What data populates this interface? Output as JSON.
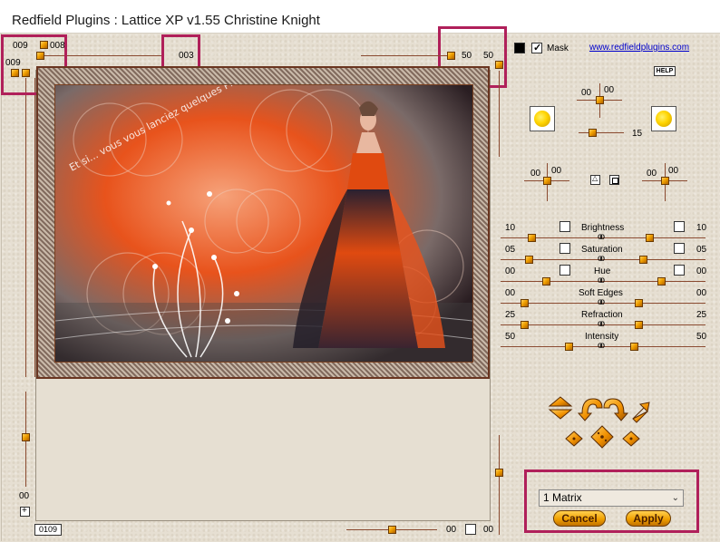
{
  "window": {
    "title": "Redfield Plugins : Lattice XP v1.55   Christine Knight"
  },
  "top_left": {
    "val_a": "009",
    "val_b": "008",
    "val_c": "009",
    "val_d": "003"
  },
  "top_right": {
    "val_a": "50",
    "val_b": "50"
  },
  "mask": {
    "label": "Mask",
    "link": "www.redfieldplugins.com",
    "help": "HELP"
  },
  "light": {
    "a": "00",
    "b": "00",
    "c": "15"
  },
  "mid": {
    "left_a": "00",
    "left_b": "00",
    "right_a": "00",
    "right_b": "00"
  },
  "sliders": [
    {
      "label": "Brightness",
      "left": "10",
      "right": "10"
    },
    {
      "label": "Saturation",
      "left": "05",
      "right": "05"
    },
    {
      "label": "Hue",
      "left": "00",
      "right": "00"
    },
    {
      "label": "Soft Edges",
      "left": "00",
      "right": "00"
    },
    {
      "label": "Refraction",
      "left": "25",
      "right": "25"
    },
    {
      "label": "Intensity",
      "left": "50",
      "right": "50"
    }
  ],
  "bottom_left": {
    "vert": "00",
    "zoom_box": "0109"
  },
  "bottom_mid": {
    "a": "00",
    "b": "00"
  },
  "preset": {
    "selected": "1 Matrix"
  },
  "buttons": {
    "cancel": "Cancel",
    "apply": "Apply"
  },
  "artwork": {
    "text": "Et si... vous vous lanciez quelques PICOTS de temps en temps ?"
  },
  "colors": {
    "accent": "#b0205a",
    "knob": "#f0a000",
    "track": "#8a4a30",
    "art_orange": "#e8531c"
  }
}
